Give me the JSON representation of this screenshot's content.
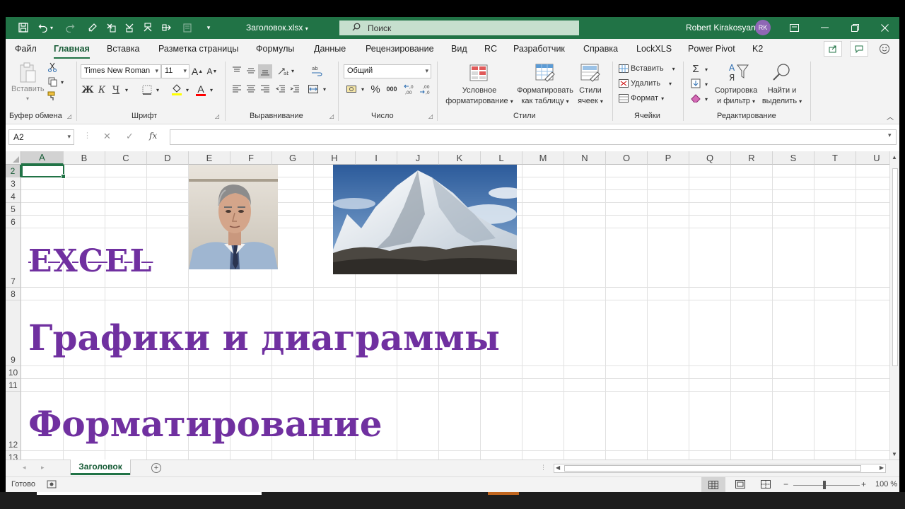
{
  "titlebar": {
    "doc_title": "Заголовок.xlsx",
    "search_placeholder": "Поиск",
    "user_name": "Robert Kirakosyan",
    "user_initials": "RK"
  },
  "menu": {
    "tabs": [
      "Файл",
      "Главная",
      "Вставка",
      "Разметка страницы",
      "Формулы",
      "Данные",
      "Рецензирование",
      "Вид",
      "RC",
      "Разработчик",
      "Справка",
      "LockXLS",
      "Power Pivot",
      "K2"
    ],
    "active": "Главная"
  },
  "ribbon": {
    "clipboard": {
      "paste": "Вставить",
      "label": "Буфер обмена"
    },
    "font": {
      "name": "Times New Roman",
      "size": "11",
      "bold": "Ж",
      "italic": "К",
      "underline": "Ч",
      "grow": "A",
      "shrink": "A",
      "color_letter": "A",
      "label": "Шрифт"
    },
    "alignment": {
      "label": "Выравнивание"
    },
    "number": {
      "format": "Общий",
      "percent": "%",
      "comma": "000",
      "label": "Число"
    },
    "styles": {
      "conditional_line1": "Условное",
      "conditional_line2": "форматирование",
      "table_line1": "Форматировать",
      "table_line2": "как таблицу",
      "cell_line1": "Стили",
      "cell_line2": "ячеек",
      "label": "Стили"
    },
    "cells": {
      "insert": "Вставить",
      "delete": "Удалить",
      "format": "Формат",
      "label": "Ячейки"
    },
    "editing": {
      "sort_line1": "Сортировка",
      "sort_line2": "и фильтр",
      "find_line1": "Найти и",
      "find_line2": "выделить",
      "label": "Редактирование"
    },
    "colors": {
      "accent": "#217346",
      "highlight": "#ffff00",
      "font_color": "#ff0000"
    }
  },
  "formula_bar": {
    "name_box": "A2",
    "fx": "fx",
    "cancel": "✕",
    "enter": "✓",
    "value": ""
  },
  "grid": {
    "columns": [
      "A",
      "B",
      "C",
      "D",
      "E",
      "F",
      "G",
      "H",
      "I",
      "J",
      "K",
      "L",
      "M",
      "N",
      "O",
      "P",
      "Q",
      "R",
      "S",
      "T",
      "U"
    ],
    "rows": [
      "2",
      "3",
      "4",
      "5",
      "6",
      "7",
      "8",
      "9",
      "10",
      "11",
      "12",
      "13"
    ],
    "selected_cell": "A2",
    "cells": {
      "A7": "EXCEL",
      "A9": "Графики и диаграммы",
      "A12": "Форматирование"
    },
    "text_color": "#7030a0"
  },
  "images": {
    "portrait": "man-portrait",
    "mountain": "snowy-mountain-peak"
  },
  "sheet_tabs": {
    "tabs": [
      "Заголовок"
    ],
    "active": "Заголовок"
  },
  "status_bar": {
    "status": "Готово",
    "zoom": "100 %"
  }
}
